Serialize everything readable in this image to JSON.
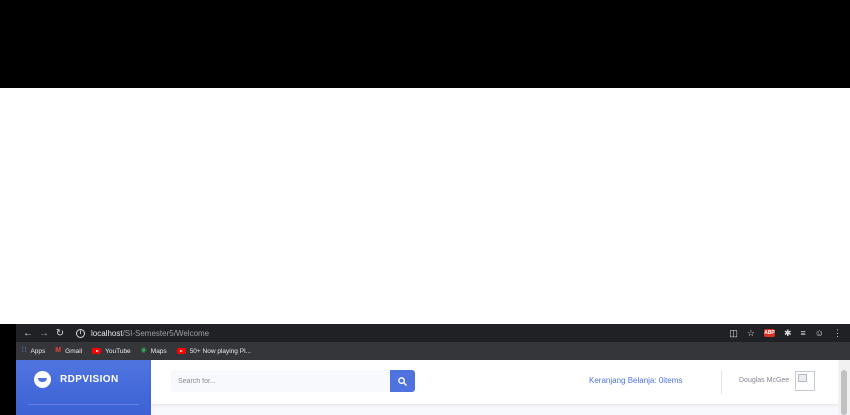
{
  "browser": {
    "url_host": "localhost",
    "url_path": "/SI-Semester5/Welcome",
    "bookmarks": [
      {
        "icon": "apps-grid-icon",
        "label": "Apps"
      },
      {
        "icon": "gmail-icon",
        "label": "Gmail"
      },
      {
        "icon": "youtube-icon",
        "label": "YouTube"
      },
      {
        "icon": "maps-pin-icon",
        "label": "Maps"
      },
      {
        "icon": "youtube-icon",
        "label": "50+ Now playing Pl..."
      }
    ],
    "extensions": [
      "translate-icon",
      "star-icon",
      "adblock-icon",
      "puzzle-icon",
      "playlist-icon",
      "profile-icon",
      "menu-kebab-icon"
    ],
    "extension_abp_label": "ABP",
    "colors": {
      "toolbar": "#202124",
      "bookmarks_bar": "#35363a"
    }
  },
  "sidebar": {
    "brand": "RDPVISION",
    "brand_icon": "laugh-wink-icon"
  },
  "topbar": {
    "search_placeholder": "Search for...",
    "search_icon": "search-icon",
    "cart_text": "Keranjang Belanja: 0items",
    "user_name": "Douglas McGee",
    "avatar": "broken-image-icon"
  },
  "colors": {
    "primary": "#4e73df",
    "background": "#f8f9fc",
    "text_muted": "#858796"
  }
}
